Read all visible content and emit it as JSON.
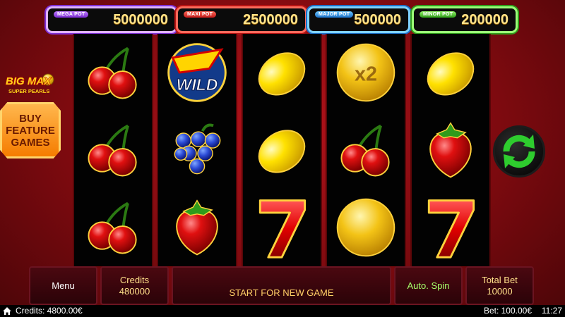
{
  "jackpots": {
    "mega": {
      "tag": "MEGA POT",
      "value": "5000000"
    },
    "maxi": {
      "tag": "MAXI POT",
      "value": "2500000"
    },
    "major": {
      "tag": "MAJOR POT",
      "value": "500000"
    },
    "minor": {
      "tag": "MINOR POT",
      "value": "200000"
    }
  },
  "logo": {
    "title": "BIG MAX",
    "subtitle": "SUPER PEARLS"
  },
  "buy_feature": {
    "line1": "BUY",
    "line2": "FEATURE",
    "line3": "GAMES"
  },
  "reels": [
    [
      "cherry-icon",
      "cherry-icon",
      "cherry-icon"
    ],
    [
      "wild-icon",
      "grapes-icon",
      "strawberry-icon"
    ],
    [
      "lemon-icon",
      "lemon-icon",
      "seven-icon"
    ],
    [
      "x2-coin-icon",
      "cherry-icon",
      "gold-coin-icon"
    ],
    [
      "lemon-icon",
      "strawberry-icon",
      "seven-icon"
    ]
  ],
  "symbols": {
    "wild_text": "WILD",
    "multiplier_text": "x2"
  },
  "controls": {
    "menu": "Menu",
    "credits_label": "Credits",
    "credits_value": "480000",
    "start": "START FOR NEW GAME",
    "auto_spin": "Auto. Spin",
    "total_bet_label": "Total Bet",
    "total_bet_value": "10000"
  },
  "status_bar": {
    "credits": "Credits: 4800.00€",
    "bet": "Bet: 100.00€",
    "clock": "11:27"
  },
  "colors": {
    "background": "#8a0b11",
    "reel_background": "#020202",
    "jackpot_value": "#ffe38a",
    "spin_arrows": "#2ecc2e",
    "buy_feature": "#f57c00"
  }
}
